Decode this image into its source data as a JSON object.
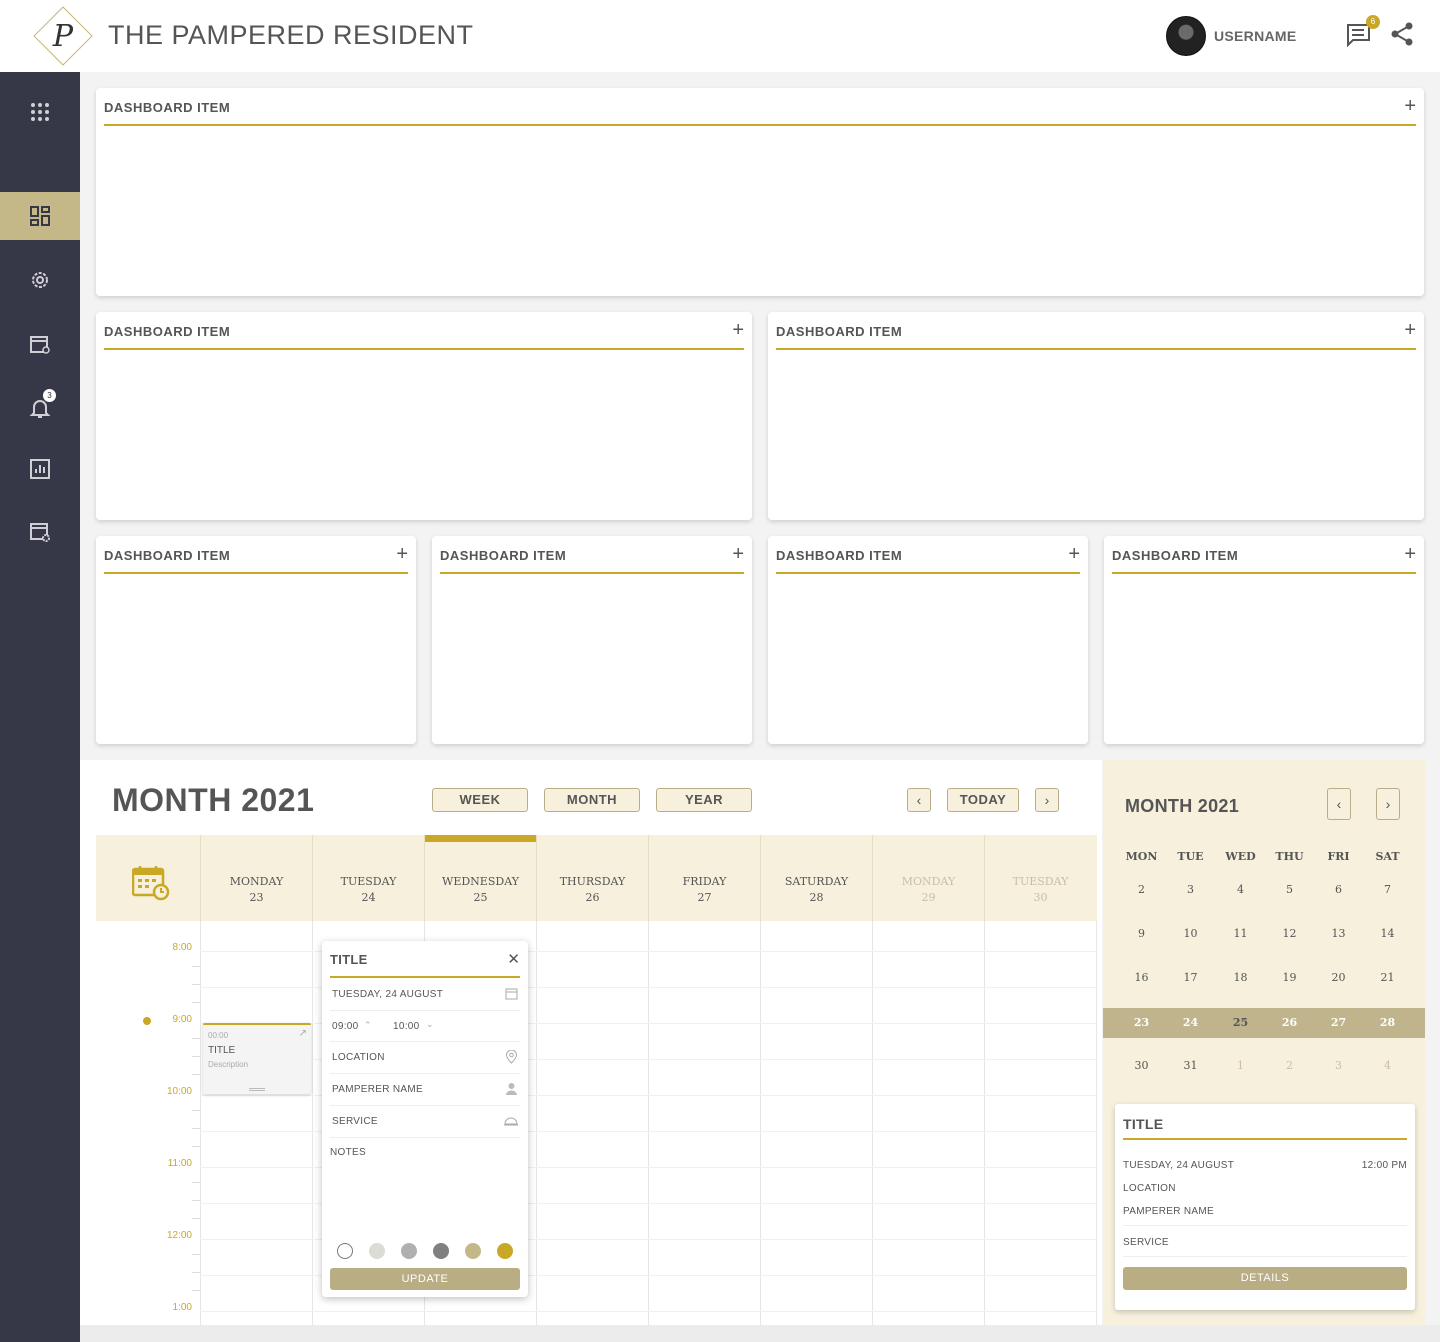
{
  "header": {
    "logo_letter": "P",
    "brand": "THE PAMPERED RESIDENT",
    "username": "USERNAME",
    "messages_badge": "6",
    "icons": [
      "chat-icon",
      "share-icon"
    ]
  },
  "sidebar": {
    "items": [
      {
        "name": "apps-grid-icon"
      },
      {
        "name": "dashboard-icon",
        "active": true
      },
      {
        "name": "settings-icon"
      },
      {
        "name": "calendar-refresh-icon"
      },
      {
        "name": "bell-icon",
        "badge": "3"
      },
      {
        "name": "analytics-icon"
      },
      {
        "name": "calendar-settings-icon"
      }
    ]
  },
  "dashboard": {
    "cards": [
      {
        "title": "DASHBOARD ITEM",
        "plus": "+"
      },
      {
        "title": "DASHBOARD ITEM",
        "plus": "+"
      },
      {
        "title": "DASHBOARD ITEM",
        "plus": "+"
      },
      {
        "title": "DASHBOARD ITEM",
        "plus": "+"
      },
      {
        "title": "DASHBOARD ITEM",
        "plus": "+"
      },
      {
        "title": "DASHBOARD ITEM",
        "plus": "+"
      },
      {
        "title": "DASHBOARD ITEM",
        "plus": "+"
      }
    ]
  },
  "calendar": {
    "title": "MONTH 2021",
    "views": [
      "WEEK",
      "MONTH",
      "YEAR"
    ],
    "prev": "‹",
    "next": "›",
    "today": "TODAY",
    "days": [
      {
        "name": "MONDAY",
        "num": "23"
      },
      {
        "name": "TUESDAY",
        "num": "24"
      },
      {
        "name": "WEDNESDAY",
        "num": "25",
        "current": true
      },
      {
        "name": "THURSDAY",
        "num": "26"
      },
      {
        "name": "FRIDAY",
        "num": "27"
      },
      {
        "name": "SATURDAY",
        "num": "28"
      },
      {
        "name": "MONDAY",
        "num": "29",
        "faded": true
      },
      {
        "name": "TUESDAY",
        "num": "30",
        "faded": true
      }
    ],
    "times": [
      "8:00",
      "9:00",
      "10:00",
      "11:00",
      "12:00",
      "1:00"
    ],
    "event": {
      "time": "00:00",
      "title": "TITLE",
      "description": "Description"
    },
    "popup": {
      "title": "TITLE",
      "close": "✕",
      "date": "TUESDAY, 24 AUGUST",
      "start": "09:00",
      "end": "10:00",
      "location": "LOCATION",
      "pamperer": "PAMPERER NAME",
      "service": "SERVICE",
      "notes": "NOTES",
      "swatches": [
        "#ffffff",
        "#dcdcdc",
        "#b0b0b0",
        "#808080",
        "#c5b888",
        "#c9a826"
      ],
      "update": "UPDATE"
    }
  },
  "mini_calendar": {
    "title": "MONTH 2021",
    "prev": "‹",
    "next": "›",
    "dow": [
      "MON",
      "TUE",
      "WED",
      "THU",
      "FRI",
      "SAT"
    ],
    "weeks": [
      [
        "2",
        "3",
        "4",
        "5",
        "6",
        "7"
      ],
      [
        "9",
        "10",
        "11",
        "12",
        "13",
        "14"
      ],
      [
        "16",
        "17",
        "18",
        "19",
        "20",
        "21"
      ],
      [
        "23",
        "24",
        "25",
        "26",
        "27",
        "28"
      ],
      [
        "30",
        "31",
        "1",
        "2",
        "3",
        "4"
      ]
    ],
    "detail": {
      "title": "TITLE",
      "date": "TUESDAY, 24 AUGUST",
      "time": "12:00 PM",
      "location": "LOCATION",
      "pamperer": "PAMPERER NAME",
      "service": "SERVICE",
      "button": "DETAILS"
    }
  }
}
